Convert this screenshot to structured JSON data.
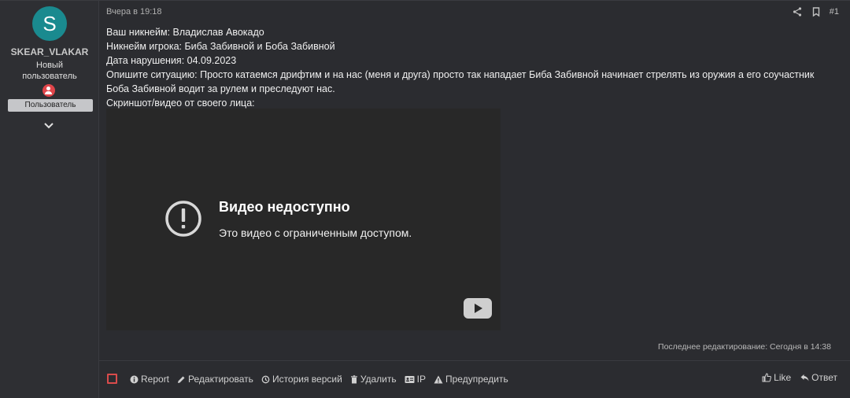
{
  "user": {
    "avatar_letter": "S",
    "name": "SKEAR_VLAKAR",
    "title": "Новый\nпользователь",
    "role": "Пользователь"
  },
  "post": {
    "date": "Вчера в 19:18",
    "number": "#1",
    "lines": [
      "Ваш никнейм: Владислав Авокадо",
      "Никнейм игрока: Биба Забивной и Боба Забивной",
      "Дата нарушения: 04.09.2023",
      "Опишите ситуацию: Просто катаемся дрифтим и на нас (меня и друга) просто так нападает Биба Забивной начинает стрелять из оружия а его соучастник Боба Забивной водит за рулем и преследуют нас.",
      "Скриншот/видео от своего лица:"
    ],
    "last_edit": "Последнее редактирование: Сегодня в 14:38"
  },
  "video": {
    "title": "Видео недоступно",
    "subtitle": "Это видео с ограниченным доступом."
  },
  "footer": {
    "report": "Report",
    "edit": "Редактировать",
    "history": "История версий",
    "delete": "Удалить",
    "ip": "IP",
    "warn": "Предупредить",
    "like": "Like",
    "reply": "Ответ"
  },
  "colors": {
    "avatar_bg": "#1a8a8f",
    "checkbox_border": "#d94b4b",
    "newbie_badge": "#e0454a"
  }
}
